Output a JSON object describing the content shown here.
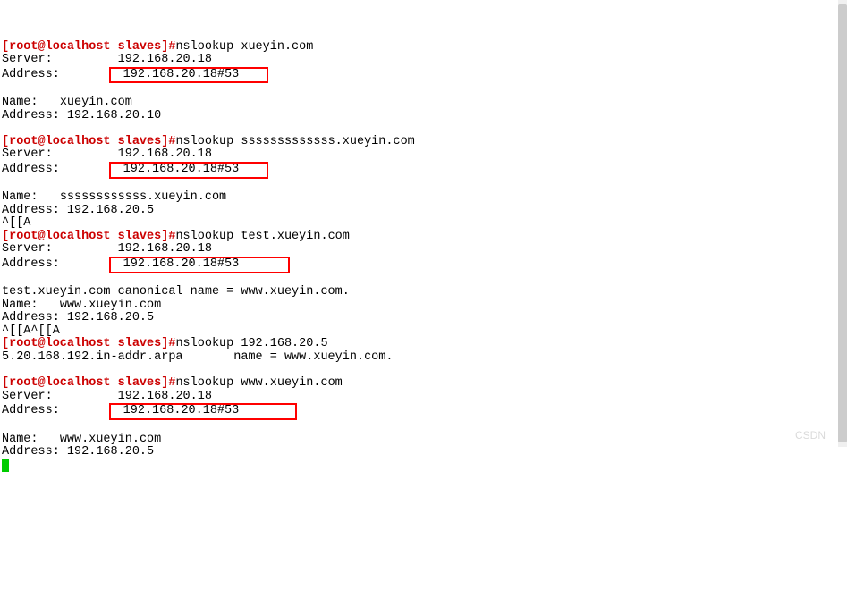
{
  "blocks": [
    {
      "prompt": "[root@localhost slaves]#",
      "command": "nslookup xueyin.com",
      "server_label": "Server:",
      "server_value": "192.168.20.18",
      "address_label": "Address:",
      "address_value": "192.168.20.18#53",
      "highlight": true,
      "result_name_label": "Name:",
      "result_name_value": "xueyin.com",
      "result_address_label": "Address:",
      "result_address_value": "192.168.20.10",
      "pre_esc": null
    },
    {
      "prompt": "[root@localhost slaves]#",
      "command": "nslookup sssssssssssss.xueyin.com",
      "server_label": "Server:",
      "server_value": "192.168.20.18",
      "address_label": "Address:",
      "address_value": "192.168.20.18#53",
      "highlight": true,
      "result_name_label": "Name:",
      "result_name_value": "ssssssssssss.xueyin.com",
      "result_address_label": "Address:",
      "result_address_value": "192.168.20.5",
      "pre_esc": null,
      "post_esc": "^[[A"
    },
    {
      "prompt": "[root@localhost slaves]#",
      "command": "nslookup test.xueyin.com",
      "server_label": "Server:",
      "server_value": "192.168.20.18",
      "address_label": "Address:",
      "address_value": "192.168.20.18#53",
      "highlight": true,
      "canonical_line": "test.xueyin.com canonical name = www.xueyin.com.",
      "result_name_label": "Name:",
      "result_name_value": "www.xueyin.com",
      "result_address_label": "Address:",
      "result_address_value": "192.168.20.5",
      "post_esc": "^[[A^[[A"
    },
    {
      "prompt": "[root@localhost slaves]#",
      "command": "nslookup 192.168.20.5",
      "reverse_line": "5.20.168.192.in-addr.arpa       name = www.xueyin.com."
    },
    {
      "prompt": "[root@localhost slaves]#",
      "command": "nslookup www.xueyin.com",
      "server_label": "Server:",
      "server_value": "192.168.20.18",
      "address_label": "Address:",
      "address_value": "192.168.20.18#53",
      "highlight": true,
      "result_name_label": "Name:",
      "result_name_value": "www.xueyin.com",
      "result_address_label": "Address:",
      "result_address_value": "192.168.20.5"
    }
  ],
  "watermark": "CSDN"
}
